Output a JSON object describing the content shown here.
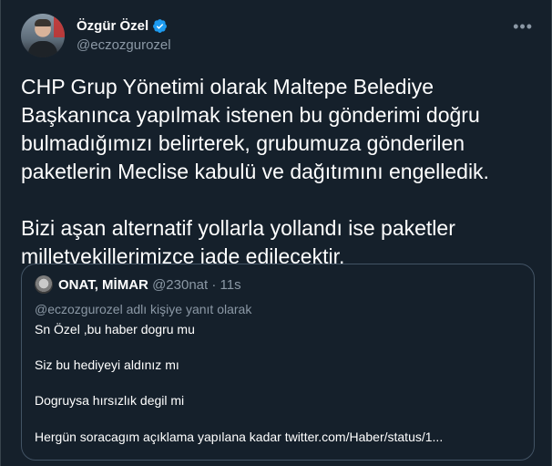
{
  "tweet": {
    "author": {
      "display_name": "Özgür Özel",
      "handle": "@eczozgurozel",
      "verified_icon": "verified-badge-icon"
    },
    "more_icon": "•••",
    "paragraphs": [
      "CHP Grup Yönetimi olarak Maltepe Belediye Başkanınca yapılmak istenen bu gönderimi doğru bulmadığımızı belirterek, grubumuza gönderilen paketlerin Meclise kabulü ve dağıtımını engelledik.",
      "Bizi aşan alternatif yollarla yollandı ise paketler milletvekillerimizce iade edilecektir."
    ],
    "accent_color": "#1d9bf0"
  },
  "quoted_tweet": {
    "author_name": "ONAT, MİMAR",
    "author_handle": "@230nat",
    "separator": "·",
    "time": "11s",
    "reply_context": "@eczozgurozel adlı kişiye yanıt olarak",
    "lines": [
      "Sn Özel ,bu haber dogru mu",
      "Siz bu hediyeyi aldınız mı",
      "Dogruysa hırsızlık degil mi",
      "Hergün soracagım açıklama yapılana kadar twitter.com/Haber/status/1..."
    ]
  }
}
